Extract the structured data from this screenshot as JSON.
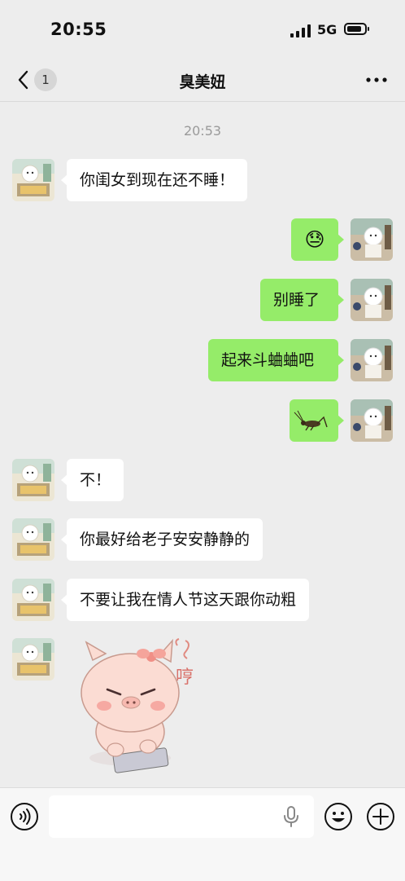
{
  "status_bar": {
    "time": "20:55",
    "network": "5G"
  },
  "nav": {
    "back_badge": "1",
    "title": "臭美妞"
  },
  "chat": {
    "timestamp": "20:53",
    "messages": [
      {
        "from": "other",
        "type": "text",
        "text": "你闺女到现在还不睡！"
      },
      {
        "from": "me",
        "type": "emoji",
        "emoji": "😓"
      },
      {
        "from": "me",
        "type": "text",
        "text": "别睡了"
      },
      {
        "from": "me",
        "type": "text",
        "text": "起来斗蛐蛐吧"
      },
      {
        "from": "me",
        "type": "image",
        "icon": "cricket-icon"
      },
      {
        "from": "other",
        "type": "text",
        "text": "不！"
      },
      {
        "from": "other",
        "type": "text",
        "text": "你最好给老子安安静静的"
      },
      {
        "from": "other",
        "type": "text",
        "text": "不要让我在情人节这天跟你动粗"
      },
      {
        "from": "other",
        "type": "sticker",
        "icon": "pig-sticker-icon",
        "sticker_text": "哼"
      }
    ]
  },
  "input": {
    "placeholder": ""
  },
  "colors": {
    "background": "#ededed",
    "outgoing_bubble": "#95ec69",
    "incoming_bubble": "#ffffff"
  }
}
